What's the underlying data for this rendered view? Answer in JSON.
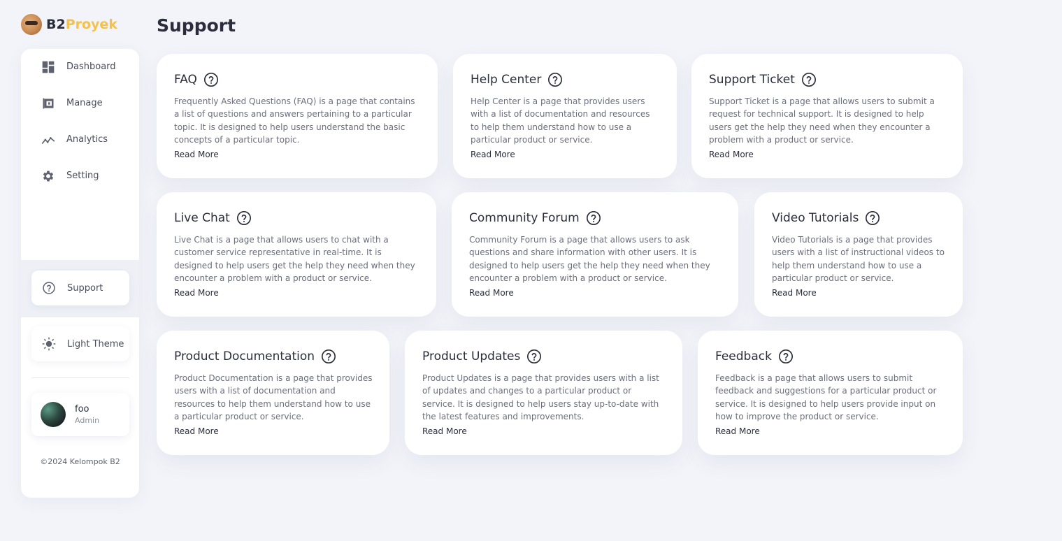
{
  "brand": {
    "name_primary": "B2",
    "name_accent": "Proyek",
    "accent_color": "#f3c14d"
  },
  "sidebar": {
    "items": [
      {
        "label": "Dashboard",
        "icon": "dashboard-icon"
      },
      {
        "label": "Manage",
        "icon": "wallet-icon"
      },
      {
        "label": "Analytics",
        "icon": "analytics-icon"
      },
      {
        "label": "Setting",
        "icon": "gear-icon"
      }
    ],
    "support_label": "Support",
    "theme_label": "Light Theme",
    "user": {
      "name": "foo",
      "role": "Admin"
    },
    "copyright": "©2024 Kelompok B2"
  },
  "page": {
    "title": "Support"
  },
  "cards": [
    {
      "title": "FAQ",
      "description": "Frequently Asked Questions (FAQ) is a page that contains a list of questions and answers pertaining to a particular topic. It is designed to help users understand the basic concepts of a particular topic.",
      "link": "Read More"
    },
    {
      "title": "Help Center",
      "description": "Help Center is a page that provides users with a list of documentation and resources to help them understand how to use a particular product or service.",
      "link": "Read More"
    },
    {
      "title": "Support Ticket",
      "description": "Support Ticket is a page that allows users to submit a request for technical support. It is designed to help users get the help they need when they encounter a problem with a product or service.",
      "link": "Read More"
    },
    {
      "title": "Live Chat",
      "description": "Live Chat is a page that allows users to chat with a customer service representative in real-time. It is designed to help users get the help they need when they encounter a problem with a product or service.",
      "link": "Read More"
    },
    {
      "title": "Community Forum",
      "description": "Community Forum is a page that allows users to ask questions and share information with other users. It is designed to help users get the help they need when they encounter a problem with a product or service.",
      "link": "Read More"
    },
    {
      "title": "Video Tutorials",
      "description": "Video Tutorials is a page that provides users with a list of instructional videos to help them understand how to use a particular product or service.",
      "link": "Read More"
    },
    {
      "title": "Product Documentation",
      "description": "Product Documentation is a page that provides users with a list of documentation and resources to help them understand how to use a particular product or service.",
      "link": "Read More"
    },
    {
      "title": "Product Updates",
      "description": "Product Updates is a page that provides users with a list of updates and changes to a particular product or service. It is designed to help users stay up-to-date with the latest features and improvements.",
      "link": "Read More"
    },
    {
      "title": "Feedback",
      "description": "Feedback is a page that allows users to submit feedback and suggestions for a particular product or service. It is designed to help users provide input on how to improve the product or service.",
      "link": "Read More"
    }
  ]
}
